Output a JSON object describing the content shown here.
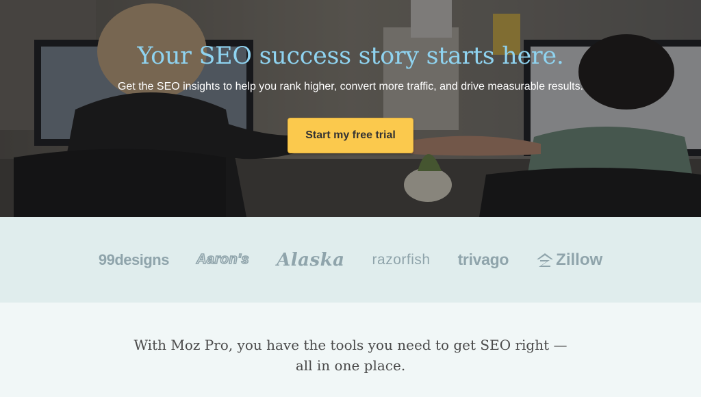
{
  "hero": {
    "title": "Your SEO success story starts here.",
    "subtitle": "Get the SEO insights to help you rank higher, convert more traffic, and drive measurable results.",
    "cta_label": "Start my free trial"
  },
  "logos": [
    {
      "name": "99designs",
      "text": "99designs"
    },
    {
      "name": "aarons",
      "text": "Aaron's"
    },
    {
      "name": "alaska",
      "text": "Alaska"
    },
    {
      "name": "razorfish",
      "text": "razorfish"
    },
    {
      "name": "trivago",
      "text": "trivago"
    },
    {
      "name": "zillow",
      "text": "Zillow"
    }
  ],
  "tagline": "With Moz Pro, you have the tools you need to get SEO right — all in one place.",
  "colors": {
    "title": "#8fd3f0",
    "cta_background": "#fbc94d",
    "logo_band": "#e0eded",
    "logo_text": "#8fa4ab",
    "lower_background": "#f1f7f7"
  }
}
